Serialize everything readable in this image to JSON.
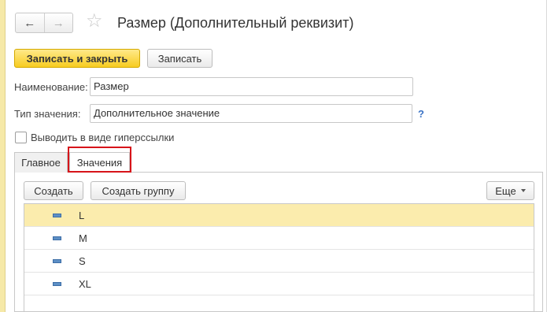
{
  "window": {
    "title": "Размер (Дополнительный реквизит)",
    "back_icon": "←",
    "forward_icon": "→",
    "star_icon": "☆"
  },
  "toolbar": {
    "save_close_label": "Записать и закрыть",
    "save_label": "Записать"
  },
  "form": {
    "name_label": "Наименование:",
    "name_value": "Размер",
    "type_label": "Тип значения:",
    "type_value": "Дополнительное значение",
    "help_label": "?",
    "hyperlink_label": "Выводить в виде гиперссылки"
  },
  "tabs": [
    {
      "label": "Главное"
    },
    {
      "label": "Значения"
    }
  ],
  "list_toolbar": {
    "create_label": "Создать",
    "create_group_label": "Создать группу",
    "more_label": "Еще"
  },
  "items": [
    {
      "label": "L"
    },
    {
      "label": "M"
    },
    {
      "label": "S"
    },
    {
      "label": "XL"
    }
  ],
  "colors": {
    "primary_button": "#f7cc21",
    "selected_row": "#fbecad",
    "highlight_border": "#d7141a",
    "help_link": "#3b73c5"
  }
}
